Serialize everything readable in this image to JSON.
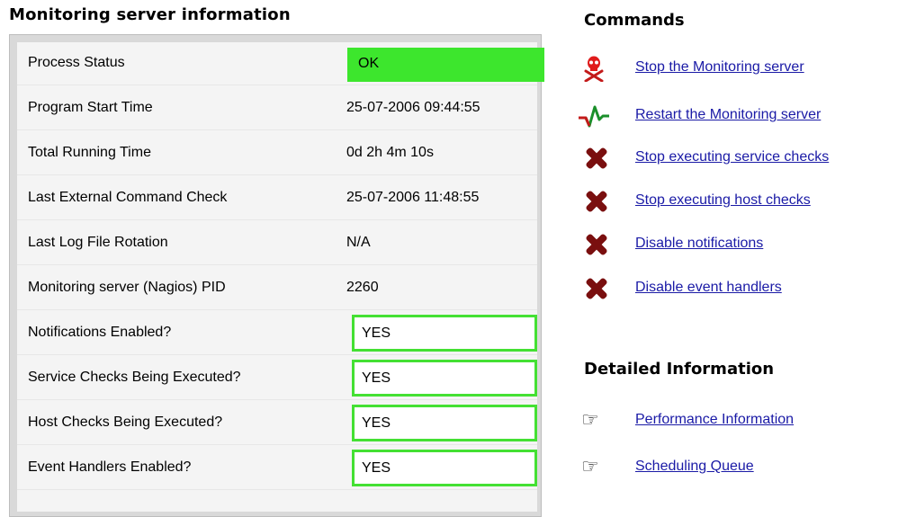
{
  "left": {
    "title": "Monitoring server information",
    "rows": [
      {
        "label": "Process Status",
        "value": "OK"
      },
      {
        "label": "Program Start Time",
        "value": "25-07-2006 09:44:55"
      },
      {
        "label": "Total Running Time",
        "value": "0d 2h 4m 10s"
      },
      {
        "label": "Last External Command Check",
        "value": "25-07-2006 11:48:55"
      },
      {
        "label": "Last Log File Rotation",
        "value": "N/A"
      },
      {
        "label": "Monitoring server (Nagios) PID",
        "value": "2260"
      },
      {
        "label": "Notifications Enabled?",
        "value": "YES"
      },
      {
        "label": "Service Checks Being Executed?",
        "value": "YES"
      },
      {
        "label": "Host Checks Being Executed?",
        "value": "YES"
      },
      {
        "label": "Event Handlers Enabled?",
        "value": "YES"
      }
    ]
  },
  "commands": {
    "title": "Commands",
    "items": [
      {
        "label": "Stop the Monitoring server",
        "icon": "skull-crossbones-icon"
      },
      {
        "label": "Restart the Monitoring server",
        "icon": "heartbeat-icon"
      },
      {
        "label": "Stop executing service checks",
        "icon": "red-x-icon"
      },
      {
        "label": "Stop executing host checks",
        "icon": "red-x-icon"
      },
      {
        "label": "Disable notifications",
        "icon": "red-x-icon"
      },
      {
        "label": "Disable event handlers",
        "icon": "red-x-icon"
      }
    ]
  },
  "detailed": {
    "title": "Detailed Information",
    "items": [
      {
        "label": "Performance Information",
        "icon": "pointing-hand-icon"
      },
      {
        "label": "Scheduling Queue",
        "icon": "pointing-hand-icon"
      }
    ]
  },
  "colors": {
    "ok_green": "#3de62d",
    "yes_border": "#44e033",
    "link_blue": "#1a1aa6",
    "x_red": "#7a0f0f"
  }
}
